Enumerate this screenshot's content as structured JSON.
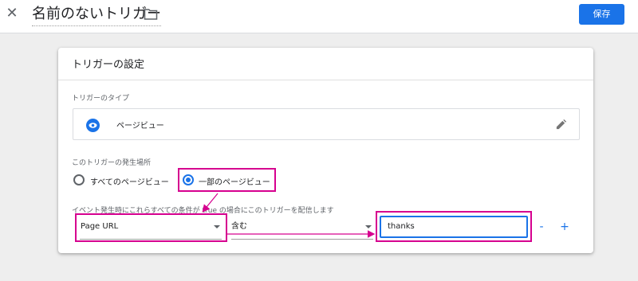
{
  "header": {
    "close_icon": "close-icon",
    "trigger_name": "名前のないトリガー",
    "folder_icon": "folder-icon",
    "save_label": "保存"
  },
  "card": {
    "title": "トリガーの設定",
    "type_section": {
      "label": "トリガーのタイプ",
      "icon": "eye-icon",
      "type_name": "ページビュー",
      "edit_icon": "pencil-icon"
    },
    "where_section": {
      "label": "このトリガーの発生場所",
      "options": [
        {
          "label": "すべてのページビュー",
          "selected": false
        },
        {
          "label": "一部のページビュー",
          "selected": true
        }
      ]
    },
    "condition_section": {
      "label": "イベント発生時にこれらすべての条件が true の場合にこのトリガーを配信します",
      "variable": "Page URL",
      "operator": "含む",
      "value": "thanks",
      "minus_label": "-",
      "plus_label": "+"
    }
  },
  "colors": {
    "accent": "#1a73e8",
    "highlight": "#d6008f",
    "background": "#eeeeee"
  }
}
